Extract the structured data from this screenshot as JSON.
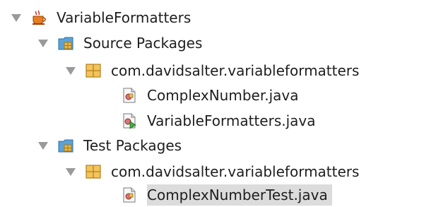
{
  "tree": {
    "project": {
      "label": "VariableFormatters",
      "icon": "coffee-cup-icon",
      "expanded": true
    },
    "source_packages": {
      "label": "Source Packages",
      "icon": "source-folder-icon",
      "expanded": true,
      "package": {
        "label": "com.davidsalter.variableformatters",
        "icon": "package-icon",
        "expanded": true
      },
      "files": [
        {
          "label": "ComplexNumber.java",
          "icon": "java-class-icon"
        },
        {
          "label": "VariableFormatters.java",
          "icon": "java-main-class-icon"
        }
      ]
    },
    "test_packages": {
      "label": "Test Packages",
      "icon": "test-folder-icon",
      "expanded": true,
      "package": {
        "label": "com.davidsalter.variableformatters",
        "icon": "package-icon",
        "expanded": true
      },
      "files": [
        {
          "label": "ComplexNumberTest.java",
          "icon": "java-class-icon",
          "selected": true
        }
      ]
    }
  },
  "colors": {
    "arrow": "#9a9a9a",
    "selection": "#dcdcdc",
    "folder": "#5aa2d8",
    "package": "#e8b64a"
  }
}
